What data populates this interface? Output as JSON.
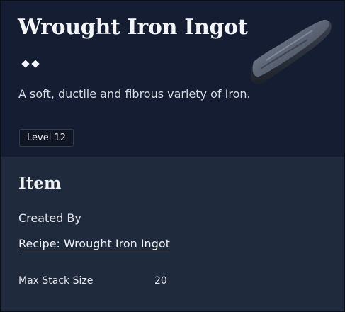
{
  "item": {
    "name": "Wrought Iron Ingot",
    "rarity_icon": "diamond-icon",
    "rarity_pips": 2,
    "description": "A soft, ductile and fibrous variety of Iron.",
    "level": "Level 12",
    "image_icon": "iron-ingot-icon"
  },
  "details": {
    "section_title": "Item",
    "created_by_label": "Created By",
    "recipe_link": "Recipe: Wrought Iron Ingot",
    "stats": [
      {
        "label": "Max Stack Size",
        "value": "20"
      }
    ]
  },
  "colors": {
    "header_bg": "#141d31",
    "body_bg": "#1f2a3c",
    "text": "#f4f5f8"
  }
}
